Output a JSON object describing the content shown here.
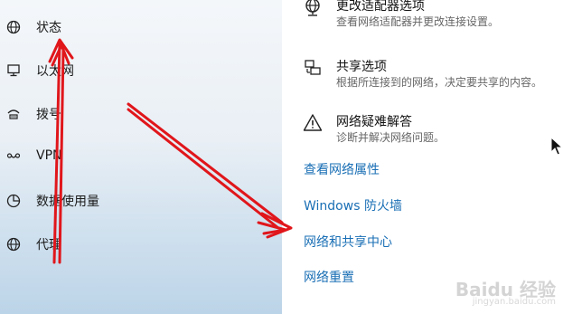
{
  "sidebar": {
    "items": [
      {
        "label": "状态",
        "icon": "status-globe-icon"
      },
      {
        "label": "以太网",
        "icon": "ethernet-monitor-icon"
      },
      {
        "label": "拨号",
        "icon": "dialup-icon"
      },
      {
        "label": "VPN",
        "icon": "vpn-icon"
      },
      {
        "label": "数据使用量",
        "icon": "data-usage-icon"
      },
      {
        "label": "代理",
        "icon": "proxy-globe-icon"
      }
    ]
  },
  "content": {
    "items": [
      {
        "title": "更改适配器选项",
        "desc": "查看网络适配器并更改连接设置。",
        "icon": "adapter-globe-icon"
      },
      {
        "title": "共享选项",
        "desc": "根据所连接到的网络，决定要共享的内容。",
        "icon": "sharing-icon"
      },
      {
        "title": "网络疑难解答",
        "desc": "诊断并解决网络问题。",
        "icon": "warning-icon"
      }
    ],
    "links": [
      "查看网络属性",
      "Windows 防火墙",
      "网络和共享中心",
      "网络重置"
    ]
  },
  "watermark": {
    "brand": "Baidu 经验",
    "url": "jingyan.baidu.com"
  },
  "colors": {
    "link": "#1a6fb5",
    "annotation_arrow": "#e0161b"
  }
}
